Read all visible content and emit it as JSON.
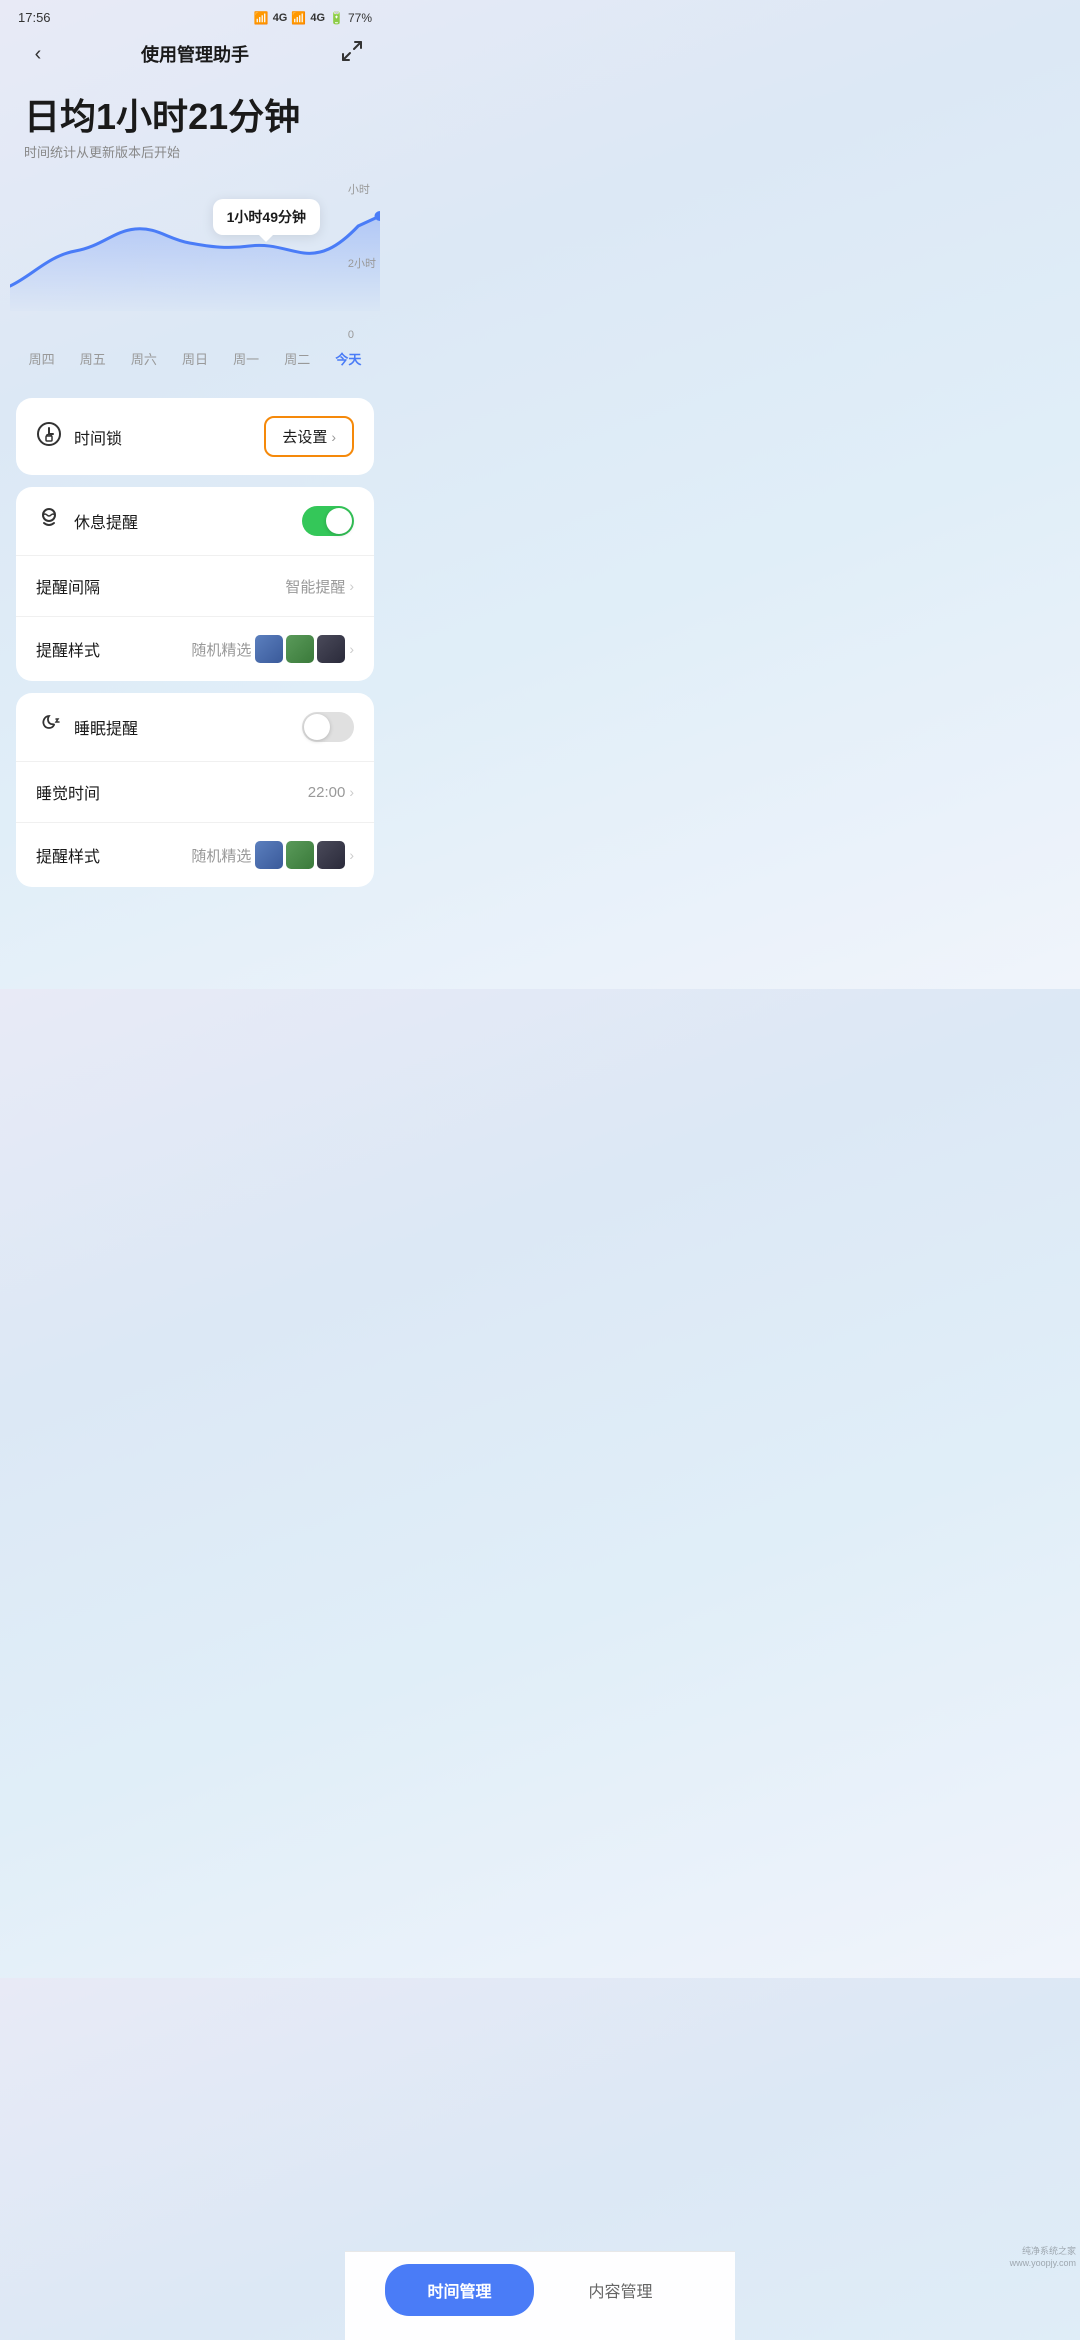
{
  "statusBar": {
    "time": "17:56",
    "battery": "77%"
  },
  "header": {
    "title": "使用管理助手",
    "backLabel": "‹",
    "shareLabel": "↗"
  },
  "stats": {
    "avgLabel": "日均",
    "hours": "1",
    "hourUnit": "小时",
    "minutes": "21",
    "minuteUnit": "分钟",
    "subtitle": "时间统计从更新版本后开始"
  },
  "chart": {
    "tooltip": "1小时49分钟",
    "yLabels": [
      "2小时",
      "0"
    ],
    "yLabelTop": "小时",
    "days": [
      "周四",
      "周五",
      "周六",
      "周日",
      "周一",
      "周二",
      "今天"
    ]
  },
  "timeLockCard": {
    "icon": "⏱",
    "label": "时间锁",
    "btnLabel": "去设置",
    "btnChevron": "›"
  },
  "restCard": {
    "title": "休息提醒",
    "icon": "☕",
    "toggleOn": true,
    "rows": [
      {
        "label": "提醒间隔",
        "value": "智能提醒",
        "hasChevron": true,
        "hasThumbs": false
      },
      {
        "label": "提醒样式",
        "value": "随机精选",
        "hasChevron": true,
        "hasThumbs": true
      }
    ]
  },
  "sleepCard": {
    "title": "睡眠提醒",
    "icon": "🌙",
    "toggleOn": false,
    "rows": [
      {
        "label": "睡觉时间",
        "value": "22:00",
        "hasChevron": true,
        "hasThumbs": false
      },
      {
        "label": "提醒样式",
        "value": "随机精选",
        "hasChevron": true,
        "hasThumbs": true
      }
    ]
  },
  "bottomNav": {
    "activeLabel": "时间管理",
    "inactiveLabel": "内容管理"
  }
}
